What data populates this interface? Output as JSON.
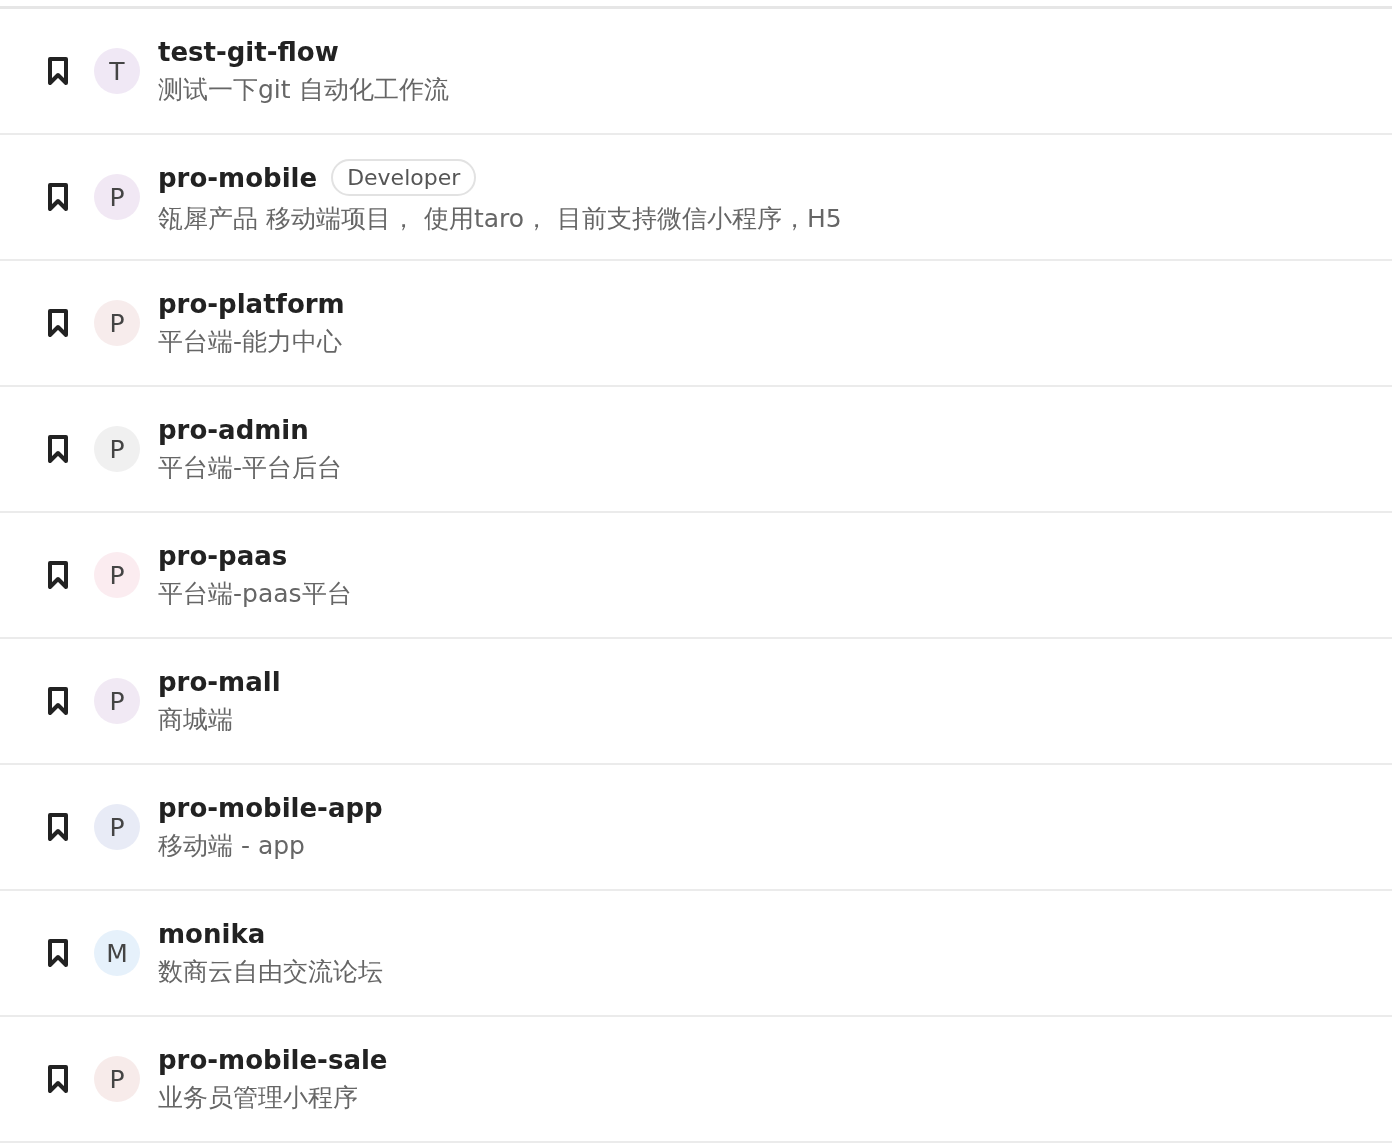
{
  "projects": [
    {
      "initial": "T",
      "color": "#f0e8f5",
      "name": "test-git-flow",
      "description": "测试一下git 自动化工作流"
    },
    {
      "initial": "P",
      "color": "#f1e8f4",
      "name": "pro-mobile",
      "role": "Developer",
      "description": "瓴犀产品 移动端项目， 使用taro， 目前支持微信小程序，H5"
    },
    {
      "initial": "P",
      "color": "#f7ecec",
      "name": "pro-platform",
      "description": "平台端-能力中心"
    },
    {
      "initial": "P",
      "color": "#f0f0f0",
      "name": "pro-admin",
      "description": "平台端-平台后台"
    },
    {
      "initial": "P",
      "color": "#fbecf0",
      "name": "pro-paas",
      "description": "平台端-paas平台"
    },
    {
      "initial": "P",
      "color": "#f1e9f4",
      "name": "pro-mall",
      "description": "商城端"
    },
    {
      "initial": "P",
      "color": "#e8ebf6",
      "name": "pro-mobile-app",
      "description": "移动端 - app"
    },
    {
      "initial": "M",
      "color": "#e6f1fb",
      "name": "monika",
      "description": "数商云自由交流论坛"
    },
    {
      "initial": "P",
      "color": "#f7ebea",
      "name": "pro-mobile-sale",
      "description": "业务员管理小程序"
    }
  ]
}
